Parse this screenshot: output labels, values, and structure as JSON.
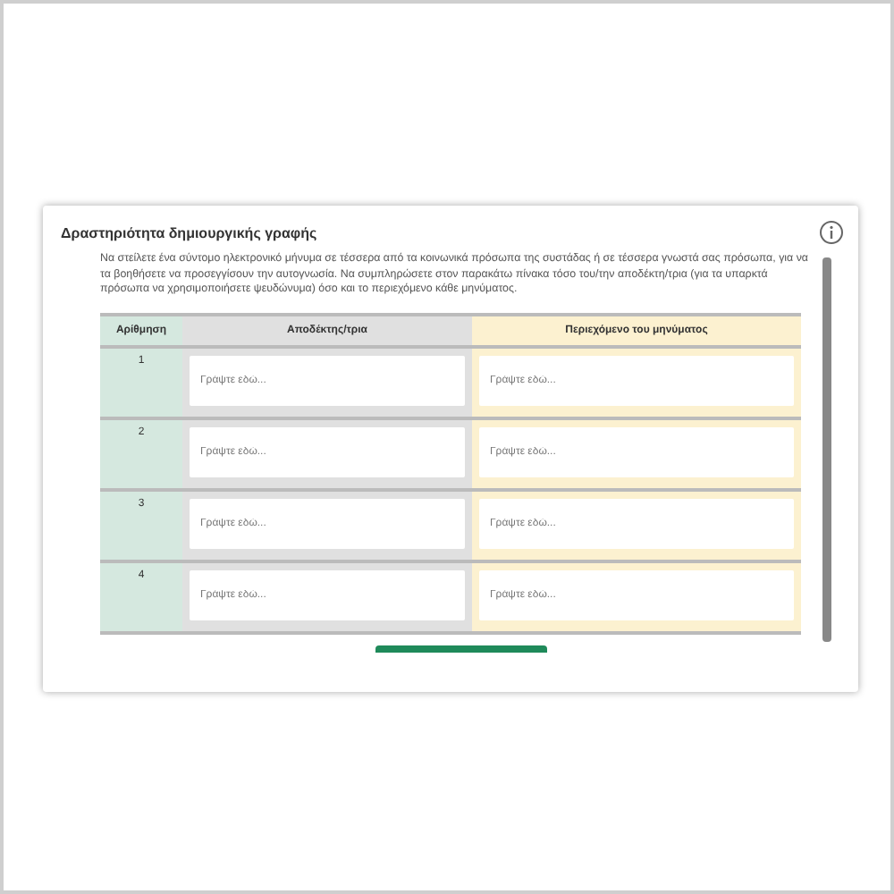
{
  "activity": {
    "title": "Δραστηριότητα δημιουργικής γραφής",
    "instructions": "Να στείλετε ένα σύντομο ηλεκτρονικό μήνυμα σε τέσσερα από τα κοινωνικά πρόσωπα της συστάδας ή σε τέσσερα γνωστά σας πρόσωπα, για να τα βοηθήσετε να προσεγγίσουν την αυτογνωσία. Να συμπληρώσετε στον παρακάτω πίνακα τόσο του/την αποδέκτη/τρια (για τα υπαρκτά πρόσωπα να χρησιμοποιήσετε ψευδώνυμα) όσο και το περιεχόμενο κάθε μηνύματος.",
    "table": {
      "columns": [
        "Αρίθμηση",
        "Αποδέκτης/τρια",
        "Περιεχόμενο του μηνύματος"
      ],
      "rows": [
        {
          "number": "1",
          "recipient_placeholder": "Γράψτε εδώ...",
          "content_placeholder": "Γράψτε εδώ..."
        },
        {
          "number": "2",
          "recipient_placeholder": "Γράψτε εδώ...",
          "content_placeholder": "Γράψτε εδώ..."
        },
        {
          "number": "3",
          "recipient_placeholder": "Γράψτε εδώ...",
          "content_placeholder": "Γράψτε εδώ..."
        },
        {
          "number": "4",
          "recipient_placeholder": "Γράψτε εδώ...",
          "content_placeholder": "Γράψτε εδώ..."
        }
      ]
    }
  }
}
